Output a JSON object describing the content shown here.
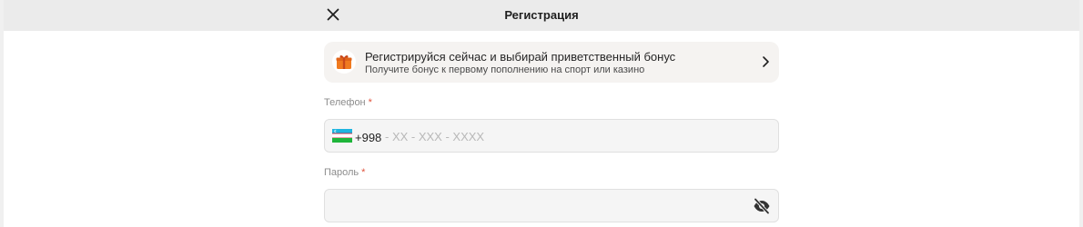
{
  "header": {
    "title": "Регистрация",
    "close_icon": "close-icon"
  },
  "bonus_banner": {
    "title": "Регистрируйся сейчас и выбирай приветственный бонус",
    "subtitle": "Получите бонус к первому пополнению на спорт или казино",
    "icon": "gift-icon",
    "chevron_icon": "chevron-right-icon"
  },
  "phone": {
    "label": "Телефон",
    "required_mark": "*",
    "country_code": "+998",
    "placeholder": "- XX - XXX - XXXX",
    "flag_icon": "uzbekistan-flag-icon"
  },
  "password": {
    "label": "Пароль",
    "required_mark": "*",
    "value": "",
    "toggle_icon": "eye-off-icon"
  },
  "colors": {
    "header_bg": "#ebebeb",
    "banner_bg": "#f5f3f1",
    "input_bg": "#f5f5f5",
    "required": "#e0533d",
    "gift_orange": "#f07a1f"
  }
}
